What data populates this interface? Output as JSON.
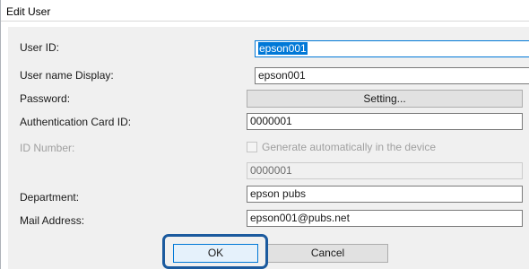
{
  "window": {
    "title": "Edit User"
  },
  "form": {
    "user_id": {
      "label": "User ID:",
      "value": "epson001"
    },
    "user_name_display": {
      "label": "User name Display:",
      "value": "epson001"
    },
    "password": {
      "label": "Password:",
      "button_label": "Setting..."
    },
    "auth_card_id": {
      "label": "Authentication Card ID:",
      "value": "0000001"
    },
    "id_number": {
      "label": "ID Number:",
      "checkbox_label": "Generate automatically in the device",
      "value": "0000001"
    },
    "department": {
      "label": "Department:",
      "value": "epson pubs"
    },
    "mail_address": {
      "label": "Mail Address:",
      "value": "epson001@pubs.net"
    }
  },
  "buttons": {
    "ok": "OK",
    "cancel": "Cancel"
  },
  "colors": {
    "highlight_border": "#1b5a9e",
    "selection": "#0078d7"
  }
}
